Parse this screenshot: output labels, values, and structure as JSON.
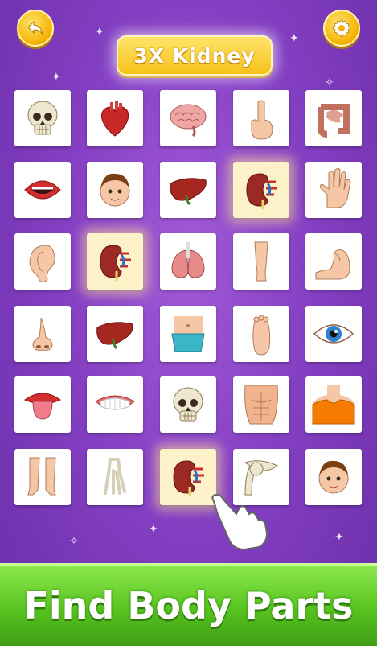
{
  "header": {
    "target_label": "3X Kidney"
  },
  "icons": {
    "back": "back-arrow-icon",
    "settings": "gear-icon"
  },
  "accent_colors": {
    "button": "#f4b100",
    "banner_green": "#56c31f",
    "background": "#8540c4"
  },
  "cards": [
    {
      "part": "skull"
    },
    {
      "part": "heart"
    },
    {
      "part": "brain"
    },
    {
      "part": "finger"
    },
    {
      "part": "intestine"
    },
    {
      "part": "mouth"
    },
    {
      "part": "face"
    },
    {
      "part": "liver"
    },
    {
      "part": "kidney",
      "highlight": true
    },
    {
      "part": "hand"
    },
    {
      "part": "ear"
    },
    {
      "part": "kidney",
      "highlight": true
    },
    {
      "part": "lungs"
    },
    {
      "part": "leg"
    },
    {
      "part": "arm"
    },
    {
      "part": "nose"
    },
    {
      "part": "liver"
    },
    {
      "part": "belly"
    },
    {
      "part": "foot"
    },
    {
      "part": "eye"
    },
    {
      "part": "tongue"
    },
    {
      "part": "teeth"
    },
    {
      "part": "skull"
    },
    {
      "part": "chest"
    },
    {
      "part": "shoulders"
    },
    {
      "part": "legs"
    },
    {
      "part": "foot-bones"
    },
    {
      "part": "kidney",
      "highlight": true
    },
    {
      "part": "shoulder-bone"
    },
    {
      "part": "face"
    }
  ],
  "footer": {
    "title": "Find Body Parts"
  }
}
